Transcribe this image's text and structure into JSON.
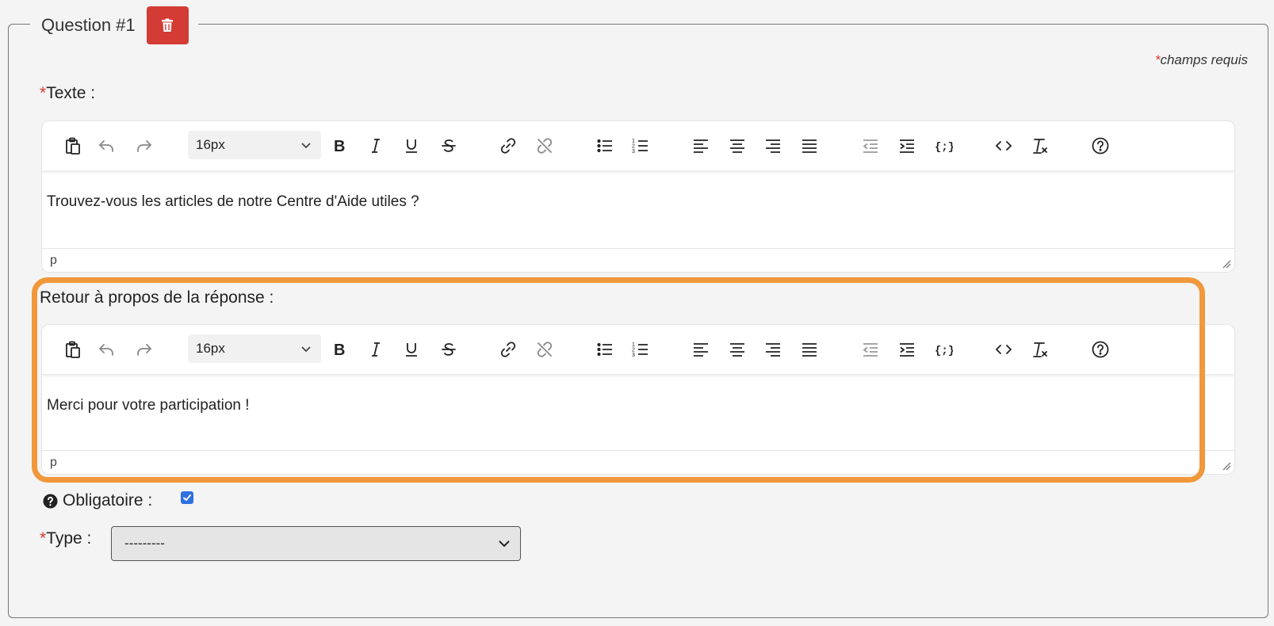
{
  "question": {
    "title": "Question #1"
  },
  "required_note": {
    "star": "*",
    "text": "champs requis"
  },
  "texte": {
    "star": "*",
    "label": "Texte :",
    "font_size": "16px",
    "content": "Trouvez-vous les articles de notre Centre d'Aide utiles ?",
    "status": "p"
  },
  "retour": {
    "label": "Retour à propos de la réponse :",
    "font_size": "16px",
    "content": "Merci pour votre participation !",
    "status": "p"
  },
  "obligatoire": {
    "label": "Obligatoire :",
    "checked": true
  },
  "type": {
    "star": "*",
    "label": "Type :",
    "selected": "---------"
  },
  "colors": {
    "danger": "#d33b35",
    "highlight": "#f0983b",
    "checkbox": "#2f6fe0"
  }
}
